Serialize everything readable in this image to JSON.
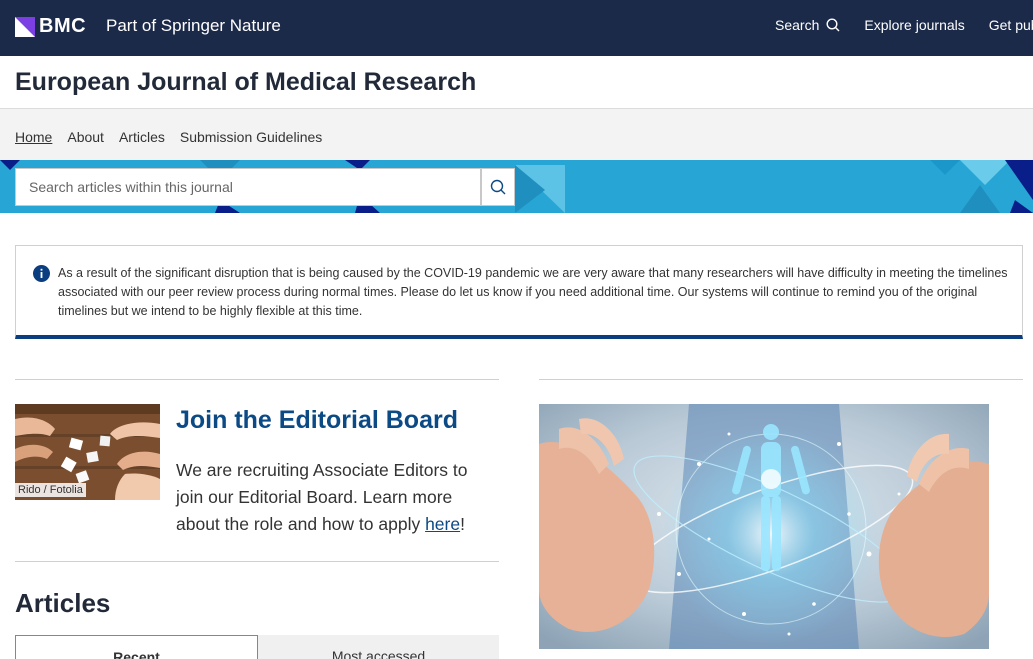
{
  "header": {
    "brand": "BMC",
    "tagline": "Part of Springer Nature",
    "nav": {
      "search_label": "Search",
      "explore_label": "Explore journals",
      "get_published_label": "Get pub"
    }
  },
  "journal": {
    "title": "European Journal of Medical Research"
  },
  "subnav": {
    "items": [
      {
        "label": "Home"
      },
      {
        "label": "About"
      },
      {
        "label": "Articles"
      },
      {
        "label": "Submission Guidelines"
      }
    ]
  },
  "search": {
    "placeholder": "Search articles within this journal"
  },
  "notice": {
    "text": "As a result of the significant disruption that is being caused by the COVID-19 pandemic we are very aware that many researchers will have difficulty in meeting the timelines associated with our peer review process during normal times.  Please do let us know if you need additional time. Our systems will continue to remind you of the original timelines but we intend to be highly flexible at this time."
  },
  "promo": {
    "image_credit": "Rido / Fotolia",
    "title": "Join the Editorial Board",
    "body": "We are recruiting Associate Editors to join our Editorial Board. Learn more about the role and how to apply ",
    "link_label": "here",
    "body_end": "!"
  },
  "articles": {
    "heading": "Articles",
    "tabs": [
      {
        "label": "Recent"
      },
      {
        "label": "Most accessed"
      }
    ]
  },
  "colors": {
    "header_bg": "#1c2a4a",
    "banner_bg": "#27a6d6",
    "accent_purple": "#7b3fe4",
    "link_blue": "#0b4a85",
    "notice_border": "#0a3e80"
  }
}
